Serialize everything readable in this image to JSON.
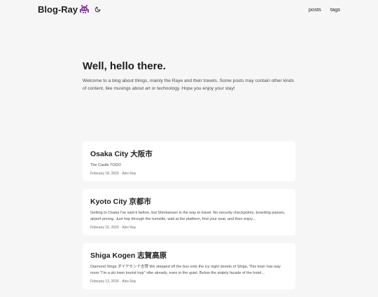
{
  "site": {
    "logo_text": "Blog-Ray",
    "logo_emoji": "👾"
  },
  "icons": {
    "logo_emoji": "alien-monster-icon",
    "theme_toggle": "moon-icon"
  },
  "menu": [
    {
      "label": "posts"
    },
    {
      "label": "tags"
    }
  ],
  "home": {
    "title": "Well, hello there.",
    "body": "Welcome to a blog about things, mainly the Raye and their travels. Some posts may contain other kinds of content, like musings about art or technology. Hope you enjoy your stay!"
  },
  "posts": [
    {
      "title": "Osaka City 大阪市",
      "summary": "The Castle TODO",
      "date": "February 18, 2026",
      "author": "Alex Ray"
    },
    {
      "title": "Kyoto City 京都市",
      "summary": "Getting to Osaka I've said it before, but Shinkansen is the way to travel. No security checkpoints, boarding passes, airport pricing. Just hop through the turnstile, wait at the platform, find your seat, and then enjoy…",
      "date": "February 16, 2026",
      "author": "Alex Ray"
    },
    {
      "title": "Shiga Kogen 志賀高原",
      "summary": "Diamond Shiga ダイヤモンド志賀 We stepped off the bus onto the icy night streets of Shiga. This town has way more \"I'm a ski town tourist trap\" vibe already, even in the quiet. Below the stately facade of the hotel…",
      "date": "February 13, 2026",
      "author": "Alex Ray"
    }
  ],
  "colors": {
    "background": "#f6f6f6",
    "card": "#ffffff",
    "text": "#1e1e1e",
    "secondary": "#4b4b4b"
  }
}
